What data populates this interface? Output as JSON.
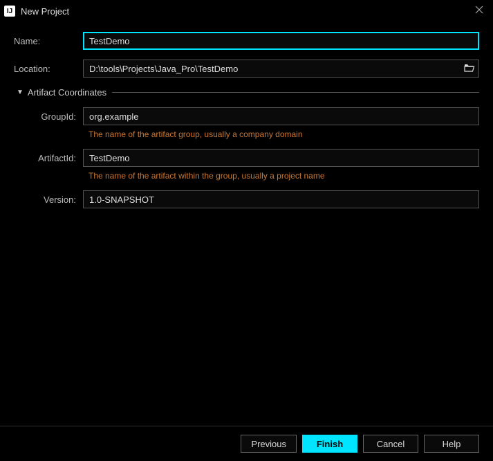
{
  "window": {
    "title": "New Project"
  },
  "form": {
    "name": {
      "label": "Name:",
      "value": "TestDemo"
    },
    "location": {
      "label": "Location:",
      "value": "D:\\tools\\Projects\\Java_Pro\\TestDemo"
    }
  },
  "artifact": {
    "section_title": "Artifact Coordinates",
    "groupId": {
      "label": "GroupId:",
      "value": "org.example",
      "hint": "The name of the artifact group, usually a company domain"
    },
    "artifactId": {
      "label": "ArtifactId:",
      "value": "TestDemo",
      "hint": "The name of the artifact within the group, usually a project name"
    },
    "version": {
      "label": "Version:",
      "value": "1.0-SNAPSHOT"
    }
  },
  "buttons": {
    "previous": "Previous",
    "finish": "Finish",
    "cancel": "Cancel",
    "help": "Help"
  }
}
